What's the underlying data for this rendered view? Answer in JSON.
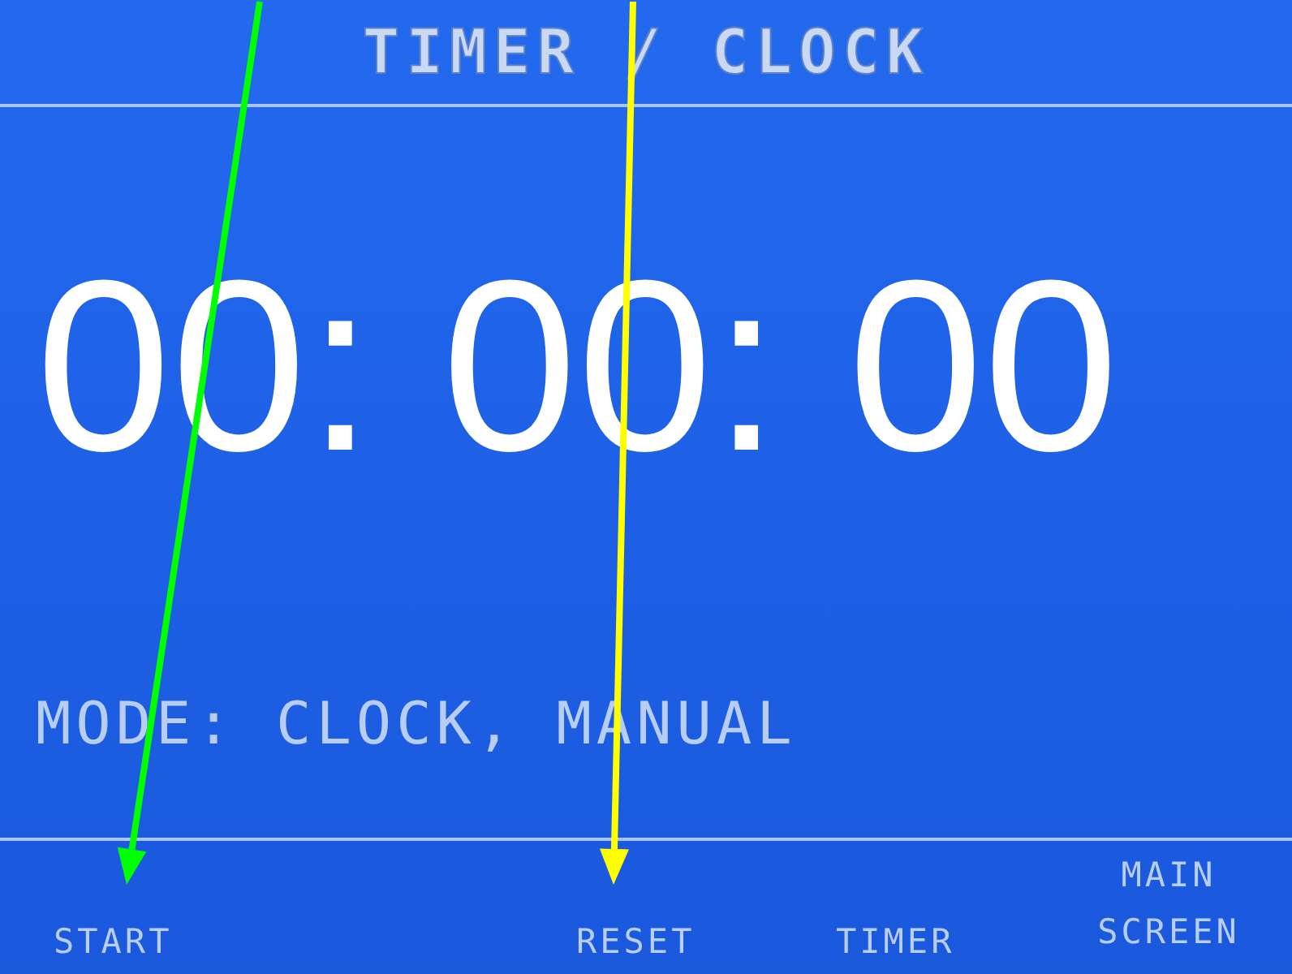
{
  "screen": {
    "title": "TIMER / CLOCK",
    "time": "00: 00: 00",
    "mode": "MODE: CLOCK, MANUAL"
  },
  "soft_keys": [
    {
      "label": "START"
    },
    {
      "label": "RESET"
    },
    {
      "label": "TIMER"
    },
    {
      "label": "MAIN SCREEN"
    }
  ],
  "arrows": [
    {
      "color": "#00ff00"
    },
    {
      "color": "#ffff00"
    }
  ]
}
